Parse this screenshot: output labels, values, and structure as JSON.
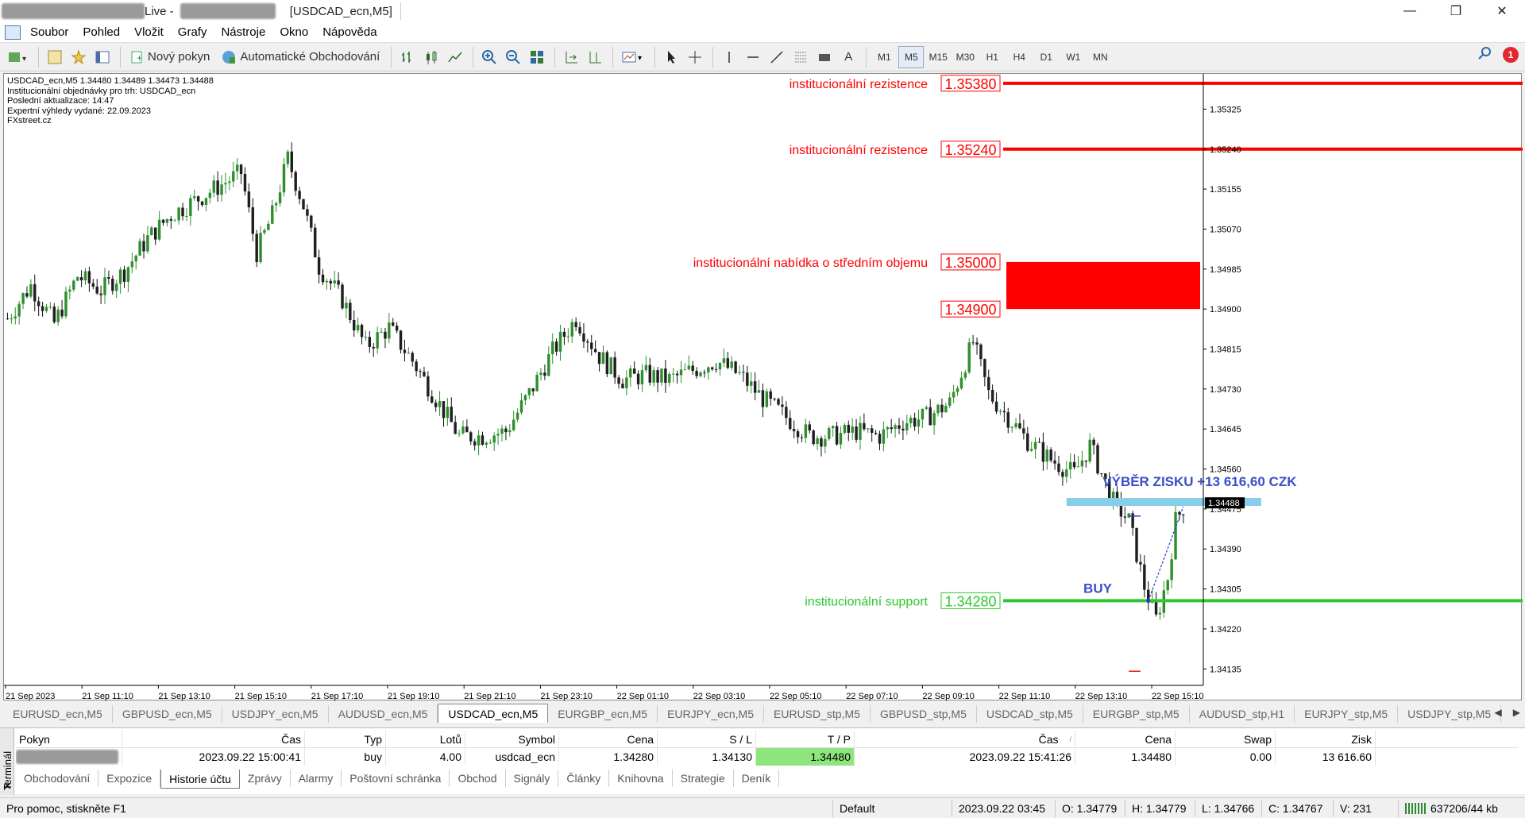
{
  "titlebar": {
    "title_live": "Live - ",
    "title_chart": "[USDCAD_ecn,M5]"
  },
  "menu": [
    "Soubor",
    "Pohled",
    "Vložit",
    "Grafy",
    "Nástroje",
    "Okno",
    "Nápověda"
  ],
  "toolbar": {
    "new_order": "Nový pokyn",
    "auto_trading": "Automatické Obchodování",
    "timeframes": [
      "M1",
      "M5",
      "M15",
      "M30",
      "H1",
      "H4",
      "D1",
      "W1",
      "MN"
    ],
    "active_timeframe": "M5",
    "text_tool": "A",
    "notif_count": "1"
  },
  "chart_info": {
    "line1": "USDCAD_ecn,M5  1.34480 1.34489 1.34473 1.34488",
    "line2": "Institucionální objednávky pro trh: USDCAD_ecn",
    "line3": "Poslední aktualizace: 14:47",
    "line4": "Expertní výhledy vydané: 22.09.2023",
    "line5": "FXstreet.cz"
  },
  "chart_data": {
    "type": "candlestick",
    "symbol": "USDCAD_ecn",
    "timeframe": "M5",
    "ylim": [
      1.341,
      1.354
    ],
    "price_ticks": [
      "1.35325",
      "1.35240",
      "1.35155",
      "1.35070",
      "1.34985",
      "1.34900",
      "1.34815",
      "1.34730",
      "1.34645",
      "1.34560",
      "1.34475",
      "1.34390",
      "1.34305",
      "1.34220",
      "1.34135"
    ],
    "current_price": "1.34488",
    "time_labels": [
      "21 Sep 2023",
      "21 Sep 11:10",
      "21 Sep 13:10",
      "21 Sep 15:10",
      "21 Sep 17:10",
      "21 Sep 19:10",
      "21 Sep 21:10",
      "21 Sep 23:10",
      "22 Sep 01:10",
      "22 Sep 03:10",
      "22 Sep 05:10",
      "22 Sep 07:10",
      "22 Sep 09:10",
      "22 Sep 11:10",
      "22 Sep 13:10",
      "22 Sep 15:10"
    ],
    "close_path": [
      [
        0,
        1.3488
      ],
      [
        6,
        1.3495
      ],
      [
        12,
        1.3487
      ],
      [
        18,
        1.3497
      ],
      [
        24,
        1.3494
      ],
      [
        30,
        1.3498
      ],
      [
        36,
        1.3505
      ],
      [
        42,
        1.351
      ],
      [
        48,
        1.3513
      ],
      [
        54,
        1.3516
      ],
      [
        60,
        1.3519
      ],
      [
        64,
        1.3502
      ],
      [
        68,
        1.351
      ],
      [
        72,
        1.3522
      ],
      [
        76,
        1.3512
      ],
      [
        80,
        1.3499
      ],
      [
        86,
        1.3492
      ],
      [
        92,
        1.3482
      ],
      [
        98,
        1.3486
      ],
      [
        104,
        1.3479
      ],
      [
        110,
        1.3471
      ],
      [
        116,
        1.3463
      ],
      [
        122,
        1.3463
      ],
      [
        128,
        1.3464
      ],
      [
        134,
        1.3472
      ],
      [
        140,
        1.3481
      ],
      [
        146,
        1.3488
      ],
      [
        152,
        1.348
      ],
      [
        158,
        1.3475
      ],
      [
        164,
        1.3476
      ],
      [
        170,
        1.3475
      ],
      [
        176,
        1.3477
      ],
      [
        182,
        1.3479
      ],
      [
        188,
        1.3476
      ],
      [
        194,
        1.3471
      ],
      [
        200,
        1.3467
      ],
      [
        206,
        1.3463
      ],
      [
        212,
        1.3463
      ],
      [
        218,
        1.3464
      ],
      [
        224,
        1.3463
      ],
      [
        230,
        1.3466
      ],
      [
        236,
        1.3467
      ],
      [
        242,
        1.347
      ],
      [
        248,
        1.3483
      ],
      [
        252,
        1.3472
      ],
      [
        256,
        1.3468
      ],
      [
        262,
        1.3462
      ],
      [
        268,
        1.3458
      ],
      [
        274,
        1.3455
      ],
      [
        278,
        1.3461
      ],
      [
        282,
        1.3453
      ],
      [
        284,
        1.3449
      ],
      [
        288,
        1.3445
      ],
      [
        292,
        1.3431
      ],
      [
        295,
        1.3424
      ],
      [
        298,
        1.3433
      ],
      [
        300,
        1.3445
      ],
      [
        302,
        1.3448
      ]
    ],
    "levels": [
      {
        "label": "institucionální rezistence",
        "price": 1.3538,
        "price_text": "1.35380",
        "color": "#ff0000"
      },
      {
        "label": "institucionální rezistence",
        "price": 1.3524,
        "price_text": "1.35240",
        "color": "#ff0000"
      },
      {
        "label": "institucionální support",
        "price": 1.3428,
        "price_text": "1.34280",
        "color": "#2ec82e"
      }
    ],
    "zone": {
      "label": "institucionální nabídka o středním objemu",
      "top": 1.35,
      "bottom": 1.349,
      "top_text": "1.35000",
      "bottom_text": "1.34900",
      "color": "#ff0000"
    },
    "take_profit": {
      "price": 1.3449,
      "color": "#87ceeb"
    },
    "annotations": {
      "profit": "VÝBĚR ZISKU +13 616,60 CZK",
      "buy": "BUY"
    },
    "trade": {
      "entry": 1.3428,
      "exit": 1.3448
    }
  },
  "symbol_tabs": [
    "EURUSD_ecn,M5",
    "GBPUSD_ecn,M5",
    "USDJPY_ecn,M5",
    "AUDUSD_ecn,M5",
    "USDCAD_ecn,M5",
    "EURGBP_ecn,M5",
    "EURJPY_ecn,M5",
    "EURUSD_stp,M5",
    "GBPUSD_stp,M5",
    "USDCAD_stp,M5",
    "EURGBP_stp,M5",
    "AUDUSD_stp,H1",
    "EURJPY_stp,M5",
    "USDJPY_stp,M5"
  ],
  "active_symbol_tab": "USDCAD_ecn,M5",
  "terminal": {
    "side_label": "Terminál",
    "columns": [
      "Pokyn",
      "Čas",
      "Typ",
      "Lotů",
      "Symbol",
      "Cena",
      "S / L",
      "T / P",
      "Čas",
      "Cena",
      "Swap",
      "Zisk"
    ],
    "row": {
      "time_open": "2023.09.22 15:00:41",
      "type": "buy",
      "lots": "4.00",
      "symbol": "usdcad_ecn",
      "price_open": "1.34280",
      "sl": "1.34130",
      "tp": "1.34480",
      "time_close": "2023.09.22 15:41:26",
      "price_close": "1.34480",
      "swap": "0.00",
      "profit": "13 616.60"
    },
    "tabs": [
      "Obchodování",
      "Expozice",
      "Historie účtu",
      "Zprávy",
      "Alarmy",
      "Poštovní schránka",
      "Obchod",
      "Signály",
      "Články",
      "Knihovna",
      "Strategie",
      "Deník"
    ],
    "active_tab": "Historie účtu"
  },
  "status": {
    "help": "Pro pomoc, stiskněte F1",
    "profile": "Default",
    "datetime": "2023.09.22 03:45",
    "open": "O: 1.34779",
    "high": "H: 1.34779",
    "low": "L: 1.34766",
    "close": "C: 1.34767",
    "volume": "V: 231",
    "traffic": "637206/44 kb"
  }
}
